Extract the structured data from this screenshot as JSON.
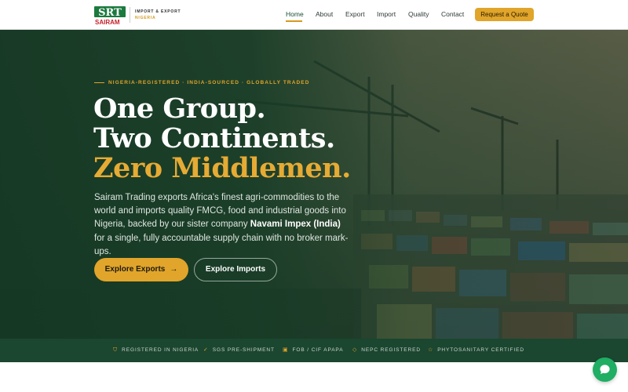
{
  "brand": {
    "logo_text": "SRT",
    "logo_name": "SAIRAM",
    "tagline_top": "IMPORT & EXPORT",
    "tagline_bottom": "NIGERIA",
    "colors": {
      "green": "#1b4d35",
      "gold": "#e0a52a",
      "red": "#c8202a"
    }
  },
  "nav": {
    "items": [
      {
        "label": "Home",
        "active": true
      },
      {
        "label": "About",
        "active": false
      },
      {
        "label": "Export",
        "active": false
      },
      {
        "label": "Import",
        "active": false
      },
      {
        "label": "Quality",
        "active": false
      },
      {
        "label": "Contact",
        "active": false
      }
    ],
    "cta_label": "Request a Quote"
  },
  "hero": {
    "eyebrow": "NIGERIA-REGISTERED · INDIA-SOURCED · GLOBALLY TRADED",
    "headline": [
      "One Group.",
      "Two Continents.",
      "Zero Middlemen."
    ],
    "description_before": "Sairam Trading exports Africa's finest agri-commodities to the world and imports quality FMCG, food and industrial goods into Nigeria, backed by our sister company ",
    "description_bold": "Navami Impex (India)",
    "description_after": " for a single, fully accountable supply chain with no broker mark-ups.",
    "primary_button": "Explore Exports",
    "primary_button_icon": "arrow-right-icon",
    "secondary_button": "Explore Imports"
  },
  "badges": [
    {
      "label": "REGISTERED IN NIGERIA",
      "icon": "shield-icon"
    },
    {
      "label": "SGS PRE-SHIPMENT",
      "icon": "check-circle-icon"
    },
    {
      "label": "FOB / CIF APAPA",
      "icon": "truck-icon"
    },
    {
      "label": "NEPC REGISTERED",
      "icon": "diamond-icon"
    },
    {
      "label": "PHYTOSANITARY CERTIFIED",
      "icon": "star-icon"
    }
  ],
  "chat": {
    "icon": "chat-bubble-icon",
    "color": "#1fae63"
  }
}
